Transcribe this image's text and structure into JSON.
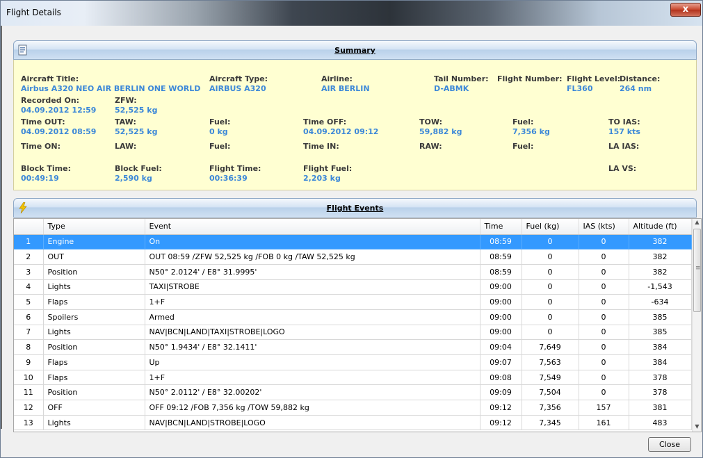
{
  "window": {
    "title": "Flight Details",
    "close_glyph": "x"
  },
  "summary": {
    "title": "Summary",
    "icon": "document-icon",
    "aircraft_title": {
      "label": "Aircraft Title:",
      "value": "Airbus A320 NEO AIR BERLIN ONE WORLD"
    },
    "aircraft_type": {
      "label": "Aircraft Type:",
      "value": "AIRBUS A320"
    },
    "airline": {
      "label": "Airline:",
      "value": "AIR BERLIN"
    },
    "tail_number": {
      "label": "Tail Number:",
      "value": "D-ABMK"
    },
    "flight_number": {
      "label": "Flight Number:",
      "value": ""
    },
    "flight_level": {
      "label": "Flight Level:",
      "value": "FL360"
    },
    "distance": {
      "label": "Distance:",
      "value": "264 nm"
    },
    "recorded_on": {
      "label": "Recorded On:",
      "value": "04.09.2012 12:59"
    },
    "zfw": {
      "label": "ZFW:",
      "value": "52,525 kg"
    },
    "time_out": {
      "label": "Time OUT:",
      "value": "04.09.2012 08:59"
    },
    "taw": {
      "label": "TAW:",
      "value": "52,525 kg"
    },
    "fuel_out": {
      "label": "Fuel:",
      "value": "0 kg"
    },
    "time_off": {
      "label": "Time OFF:",
      "value": "04.09.2012 09:12"
    },
    "tow": {
      "label": "TOW:",
      "value": "59,882 kg"
    },
    "fuel_off": {
      "label": "Fuel:",
      "value": "7,356 kg"
    },
    "to_ias": {
      "label": "TO IAS:",
      "value": "157 kts"
    },
    "time_on": {
      "label": "Time ON:",
      "value": ""
    },
    "law": {
      "label": "LAW:",
      "value": ""
    },
    "fuel_on": {
      "label": "Fuel:",
      "value": ""
    },
    "time_in": {
      "label": "Time IN:",
      "value": ""
    },
    "raw": {
      "label": "RAW:",
      "value": ""
    },
    "fuel_in": {
      "label": "Fuel:",
      "value": ""
    },
    "la_ias": {
      "label": "LA IAS:",
      "value": ""
    },
    "block_time": {
      "label": "Block Time:",
      "value": "00:49:19"
    },
    "block_fuel": {
      "label": "Block Fuel:",
      "value": "2,590 kg"
    },
    "flight_time": {
      "label": "Flight Time:",
      "value": "00:36:39"
    },
    "flight_fuel": {
      "label": "Flight Fuel:",
      "value": "2,203 kg"
    },
    "la_vs": {
      "label": "LA VS:",
      "value": ""
    }
  },
  "events": {
    "title": "Flight Events",
    "icon": "lightning-icon",
    "columns": [
      "",
      "Type",
      "Event",
      "Time",
      "Fuel (kg)",
      "IAS (kts)",
      "Altitude (ft)"
    ],
    "selected_row": 0,
    "rows": [
      [
        "1",
        "Engine",
        "On",
        "08:59",
        "0",
        "0",
        "382"
      ],
      [
        "2",
        "OUT",
        "OUT 08:59 /ZFW 52,525 kg /FOB 0 kg /TAW 52,525 kg",
        "08:59",
        "0",
        "0",
        "382"
      ],
      [
        "3",
        "Position",
        "N50° 2.0124' / E8° 31.9995'",
        "08:59",
        "0",
        "0",
        "382"
      ],
      [
        "4",
        "Lights",
        "TAXI|STROBE",
        "09:00",
        "0",
        "0",
        "-1,543"
      ],
      [
        "5",
        "Flaps",
        "1+F",
        "09:00",
        "0",
        "0",
        "-634"
      ],
      [
        "6",
        "Spoilers",
        "Armed",
        "09:00",
        "0",
        "0",
        "385"
      ],
      [
        "7",
        "Lights",
        "NAV|BCN|LAND|TAXI|STROBE|LOGO",
        "09:00",
        "0",
        "0",
        "385"
      ],
      [
        "8",
        "Position",
        "N50° 1.9434' / E8° 32.1411'",
        "09:04",
        "7,649",
        "0",
        "384"
      ],
      [
        "9",
        "Flaps",
        "Up",
        "09:07",
        "7,563",
        "0",
        "384"
      ],
      [
        "10",
        "Flaps",
        "1+F",
        "09:08",
        "7,549",
        "0",
        "378"
      ],
      [
        "11",
        "Position",
        "N50° 2.0112' / E8° 32.00202'",
        "09:09",
        "7,504",
        "0",
        "378"
      ],
      [
        "12",
        "OFF",
        "OFF 09:12 /FOB 7,356 kg /TOW 59,882 kg",
        "09:12",
        "7,356",
        "157",
        "381"
      ],
      [
        "13",
        "Lights",
        "NAV|BCN|LAND|STROBE|LOGO",
        "09:12",
        "7,345",
        "161",
        "483"
      ]
    ]
  },
  "footer": {
    "close_label": "Close"
  },
  "colors": {
    "value_blue": "#3c88d8",
    "selection_blue": "#3399ff",
    "summary_bg": "#ffffd2"
  }
}
